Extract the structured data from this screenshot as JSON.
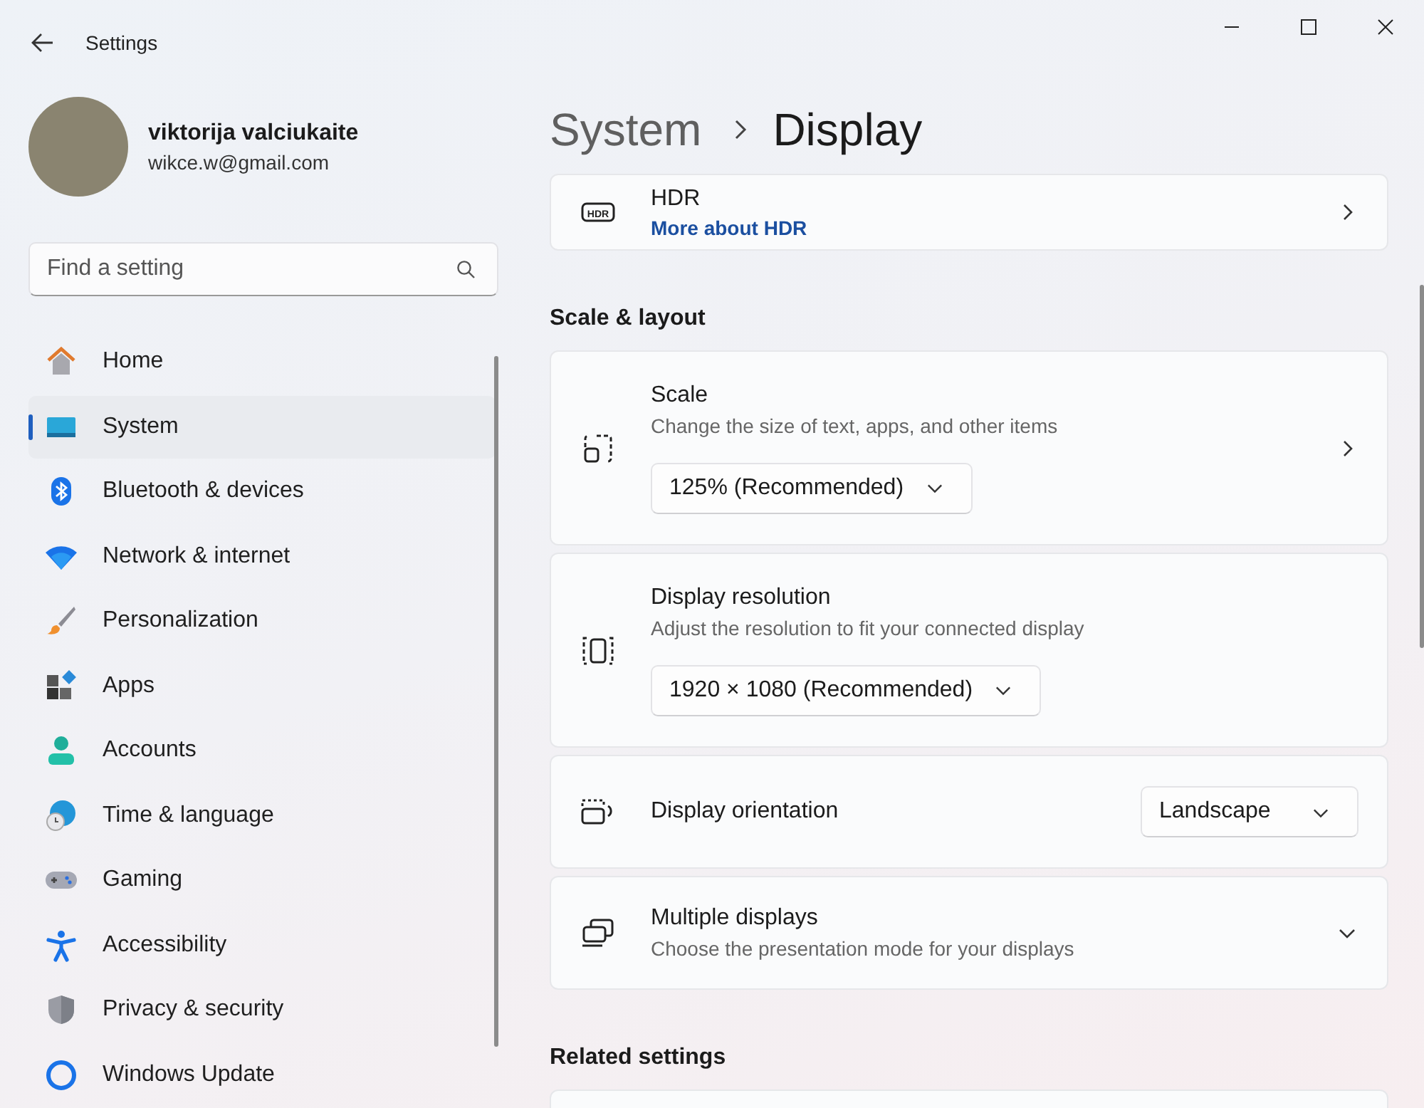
{
  "window": {
    "title": "Settings"
  },
  "user": {
    "name": "viktorija valciukaite",
    "email": "wikce.w@gmail.com"
  },
  "search": {
    "placeholder": "Find a setting"
  },
  "nav": [
    {
      "label": "Home",
      "selected": false
    },
    {
      "label": "System",
      "selected": true
    },
    {
      "label": "Bluetooth & devices",
      "selected": false
    },
    {
      "label": "Network & internet",
      "selected": false
    },
    {
      "label": "Personalization",
      "selected": false
    },
    {
      "label": "Apps",
      "selected": false
    },
    {
      "label": "Accounts",
      "selected": false
    },
    {
      "label": "Time & language",
      "selected": false
    },
    {
      "label": "Gaming",
      "selected": false
    },
    {
      "label": "Accessibility",
      "selected": false
    },
    {
      "label": "Privacy & security",
      "selected": false
    },
    {
      "label": "Windows Update",
      "selected": false
    }
  ],
  "breadcrumb": {
    "parent": "System",
    "current": "Display"
  },
  "content": [
    {
      "kind": "card",
      "icon_text": "HDR",
      "title": "HDR",
      "link": "More about HDR"
    },
    {
      "kind": "heading",
      "text": "Scale & layout"
    },
    {
      "kind": "card",
      "title": "Scale",
      "subtitle": "Change the size of text, apps, and other items",
      "dropdown": "125% (Recommended)"
    },
    {
      "kind": "card",
      "title": "Display resolution",
      "subtitle": "Adjust the resolution to fit your connected display",
      "dropdown": "1920 × 1080 (Recommended)"
    },
    {
      "kind": "card",
      "title": "Display orientation",
      "side_dropdown": "Landscape"
    },
    {
      "kind": "card",
      "title": "Multiple displays",
      "subtitle": "Choose the presentation mode for your displays",
      "expanded": false
    },
    {
      "kind": "heading",
      "text": "Related settings"
    },
    {
      "kind": "blank"
    }
  ]
}
